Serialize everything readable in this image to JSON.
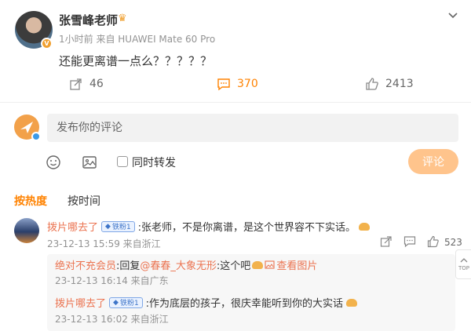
{
  "post": {
    "author": "张雪峰老师",
    "meta": "1小时前 来自 HUAWEI Mate 60 Pro",
    "content": "还能更离谱一点么？？？？？",
    "actions": {
      "forward": "46",
      "comment": "370",
      "like": "2413"
    }
  },
  "composer": {
    "placeholder": "发布你的评论",
    "also_forward": "同时转发",
    "submit": "评论"
  },
  "sort_tabs": {
    "hot": "按热度",
    "time": "按时间"
  },
  "comment": {
    "author": "拨片哪去了",
    "fan_badge": "铁粉1",
    "text": ":张老师，不是你离谱，是这个世界容不下实话。",
    "time": "23-12-13 15:59 来自浙江",
    "like_count": "523"
  },
  "replies": [
    {
      "author": "绝对不充会员",
      "prefix": ":回复",
      "mention": "@春春_大象无形",
      "text": ":这个吧",
      "pic": "查看图片",
      "time": "23-12-13 16:14 来自广东"
    },
    {
      "author": "拨片哪去了",
      "fan_badge": "铁粉1",
      "text": ":作为底层的孩子，很庆幸能听到你的大实话",
      "time": "23-12-13 16:02 来自浙江"
    }
  ],
  "side": {
    "top_label": "TOP"
  },
  "colors": {
    "accent": "#ff8200",
    "link": "#eb7350",
    "muted": "#939393"
  }
}
